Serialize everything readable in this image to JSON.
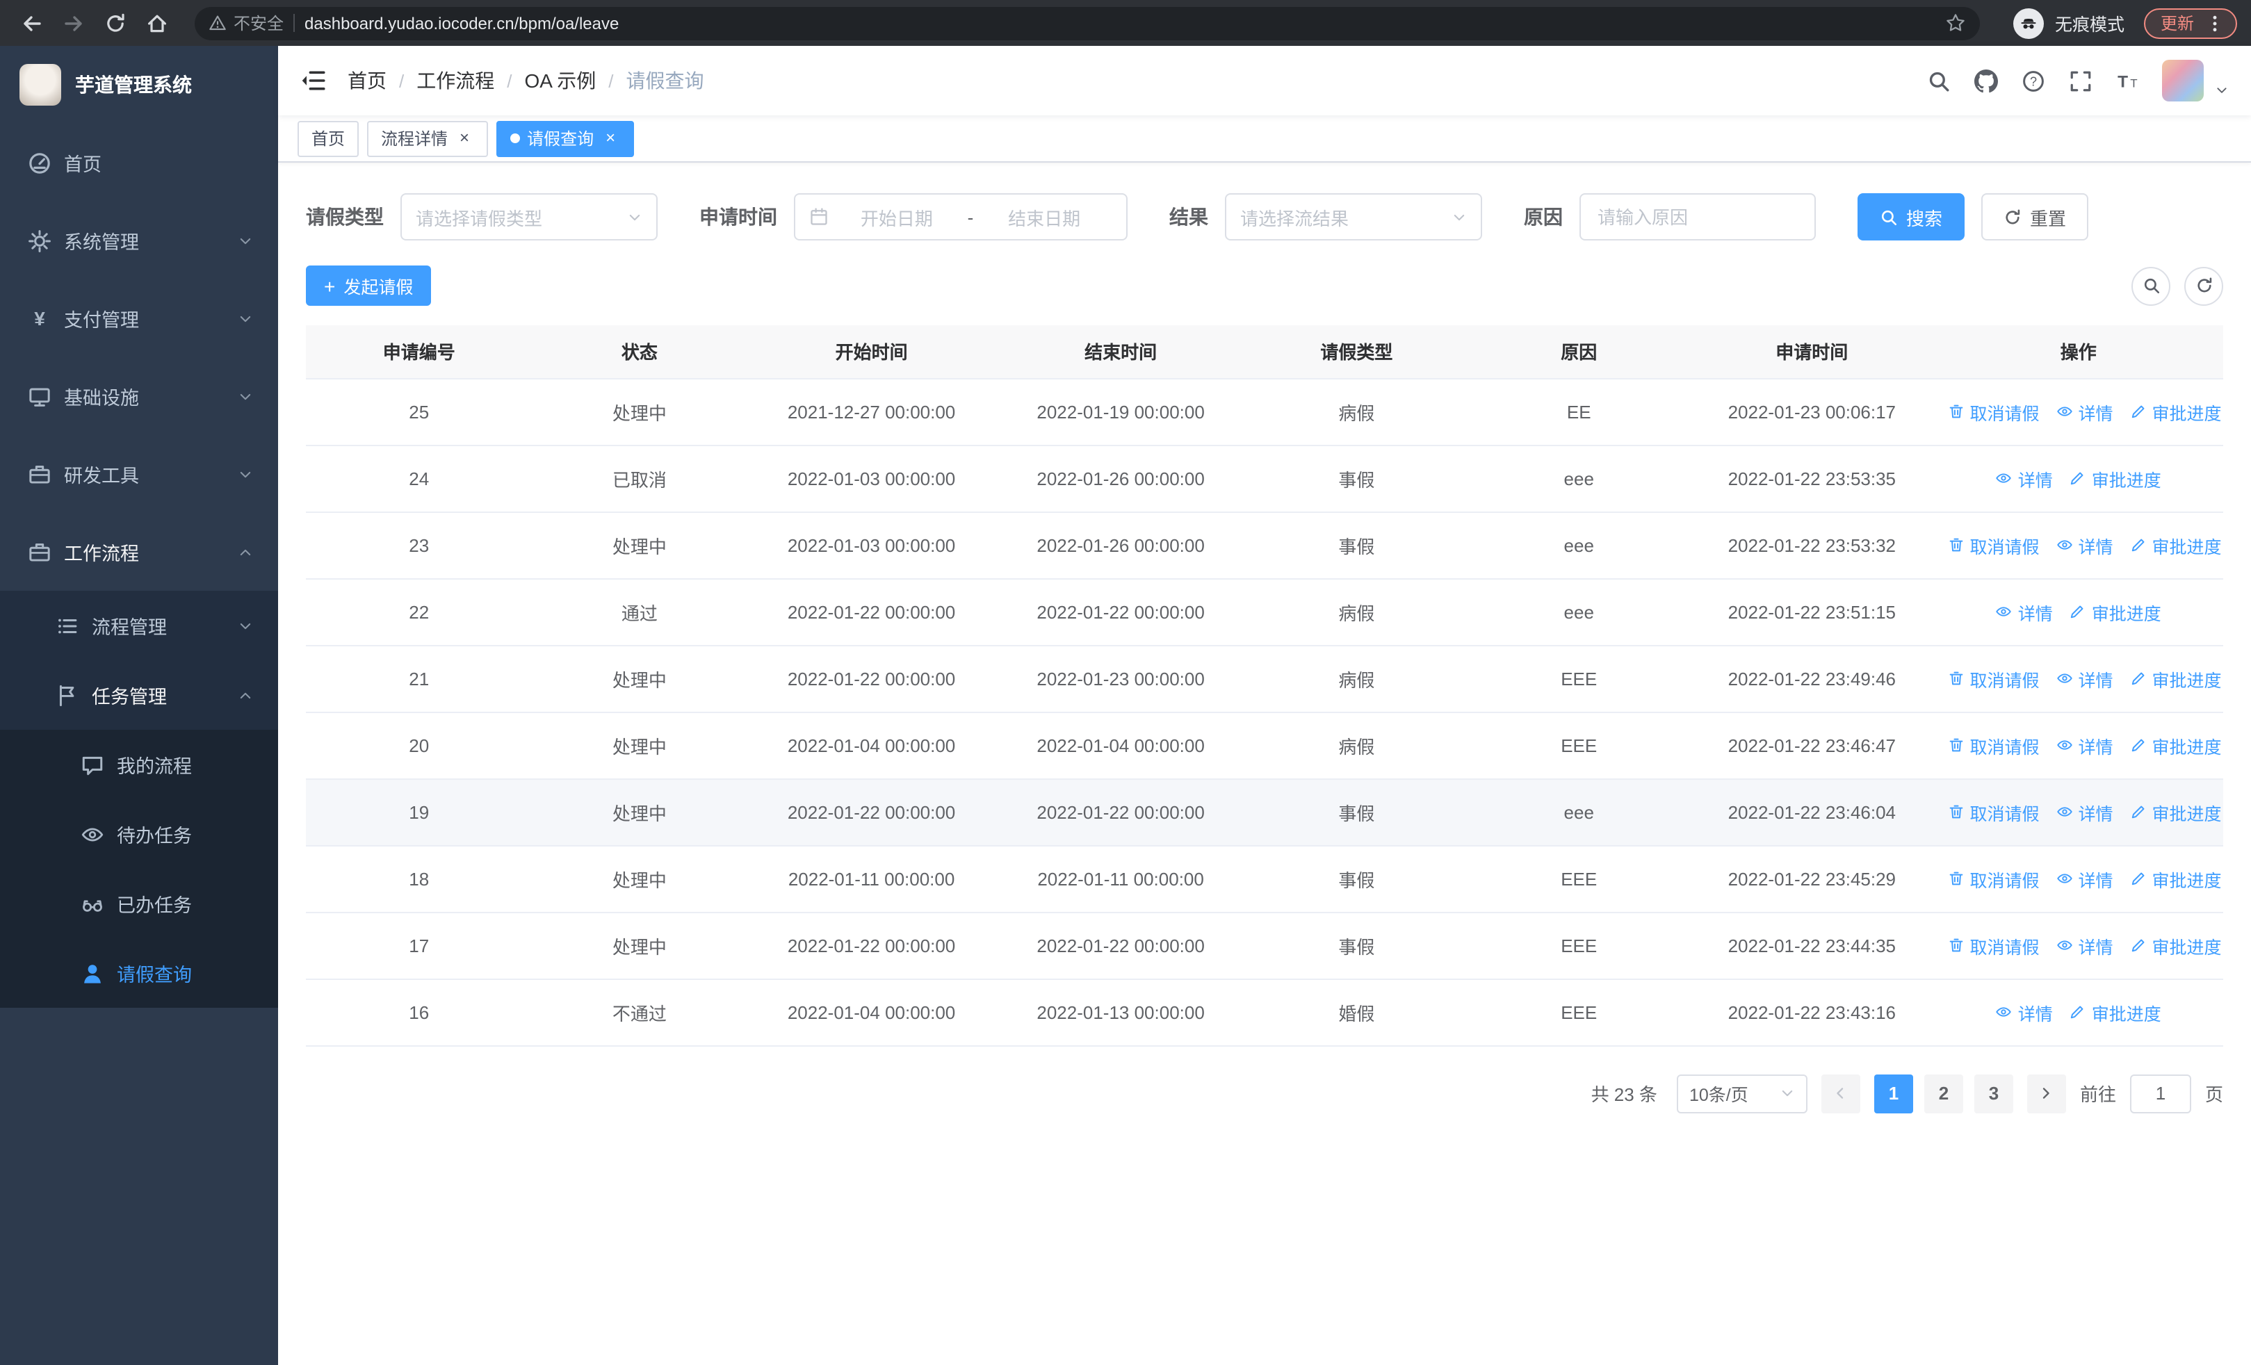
{
  "colors": {
    "accent": "#409eff",
    "sidebar_bg": "#2d3a4d",
    "submenu_bg": "#1b2532"
  },
  "browser": {
    "security_warning": "不安全",
    "url": "dashboard.yudao.iocoder.cn/bpm/oa/leave",
    "incognito_label": "无痕模式",
    "update_label": "更新"
  },
  "sidebar": {
    "logo_title": "芋道管理系统",
    "menu": [
      {
        "key": "home",
        "label": "首页",
        "icon": "dashboard-icon",
        "level": 1
      },
      {
        "key": "system",
        "label": "系统管理",
        "icon": "gear-icon",
        "level": 1,
        "arrow": "down"
      },
      {
        "key": "payment",
        "label": "支付管理",
        "icon": "yen-icon",
        "level": 1,
        "arrow": "down"
      },
      {
        "key": "infrastructure",
        "label": "基础设施",
        "icon": "monitor-icon",
        "level": 1,
        "arrow": "down"
      },
      {
        "key": "dev-tools",
        "label": "研发工具",
        "icon": "suitcase-icon",
        "level": 1,
        "arrow": "down"
      },
      {
        "key": "workflow",
        "label": "工作流程",
        "icon": "suitcase-icon",
        "level": 1,
        "arrow": "up",
        "open": true
      },
      {
        "key": "process-mgmt",
        "label": "流程管理",
        "icon": "list-icon",
        "level": 2,
        "arrow": "down"
      },
      {
        "key": "task-mgmt",
        "label": "任务管理",
        "icon": "flag-icon",
        "level": 2,
        "arrow": "up",
        "open": true
      },
      {
        "key": "my-process",
        "label": "我的流程",
        "icon": "chat-icon",
        "level": 3
      },
      {
        "key": "todo-tasks",
        "label": "待办任务",
        "icon": "eye-icon",
        "level": 3
      },
      {
        "key": "done-tasks",
        "label": "已办任务",
        "icon": "glasses-icon",
        "level": 3
      },
      {
        "key": "leave-query",
        "label": "请假查询",
        "icon": "user-icon",
        "level": 3,
        "active": true
      }
    ]
  },
  "header": {
    "breadcrumb": [
      "首页",
      "工作流程",
      "OA 示例",
      "请假查询"
    ],
    "icons": [
      {
        "name": "search-icon"
      },
      {
        "name": "github-icon"
      },
      {
        "name": "question-icon"
      },
      {
        "name": "fullscreen-icon"
      },
      {
        "name": "font-size-icon"
      }
    ]
  },
  "tabs": [
    {
      "label": "首页",
      "closable": false,
      "active": false
    },
    {
      "label": "流程详情",
      "closable": true,
      "active": false
    },
    {
      "label": "请假查询",
      "closable": true,
      "active": true
    }
  ],
  "filters": {
    "leave_type_label": "请假类型",
    "leave_type_placeholder": "请选择请假类型",
    "apply_time_label": "申请时间",
    "start_date_placeholder": "开始日期",
    "date_separator": "-",
    "end_date_placeholder": "结束日期",
    "result_label": "结果",
    "result_placeholder": "请选择流结果",
    "reason_label": "原因",
    "reason_placeholder": "请输入原因",
    "search_label": "搜索",
    "reset_label": "重置"
  },
  "toolbar": {
    "create_label": "发起请假"
  },
  "table": {
    "headers": [
      "申请编号",
      "状态",
      "开始时间",
      "结束时间",
      "请假类型",
      "原因",
      "申请时间",
      "操作"
    ],
    "action_labels": {
      "cancel": "取消请假",
      "detail": "详情",
      "progress": "审批进度"
    },
    "action_icons": {
      "cancel": "trash-icon",
      "detail": "eye-icon",
      "progress": "edit-icon"
    },
    "rows": [
      {
        "id": "25",
        "status": "处理中",
        "start": "2021-12-27 00:00:00",
        "end": "2022-01-19 00:00:00",
        "type": "病假",
        "reason": "EE",
        "apply_time": "2022-01-23 00:06:17",
        "actions": [
          "cancel",
          "detail",
          "progress"
        ]
      },
      {
        "id": "24",
        "status": "已取消",
        "start": "2022-01-03 00:00:00",
        "end": "2022-01-26 00:00:00",
        "type": "事假",
        "reason": "eee",
        "apply_time": "2022-01-22 23:53:35",
        "actions": [
          "detail",
          "progress"
        ]
      },
      {
        "id": "23",
        "status": "处理中",
        "start": "2022-01-03 00:00:00",
        "end": "2022-01-26 00:00:00",
        "type": "事假",
        "reason": "eee",
        "apply_time": "2022-01-22 23:53:32",
        "actions": [
          "cancel",
          "detail",
          "progress"
        ]
      },
      {
        "id": "22",
        "status": "通过",
        "start": "2022-01-22 00:00:00",
        "end": "2022-01-22 00:00:00",
        "type": "病假",
        "reason": "eee",
        "apply_time": "2022-01-22 23:51:15",
        "actions": [
          "detail",
          "progress"
        ]
      },
      {
        "id": "21",
        "status": "处理中",
        "start": "2022-01-22 00:00:00",
        "end": "2022-01-23 00:00:00",
        "type": "病假",
        "reason": "EEE",
        "apply_time": "2022-01-22 23:49:46",
        "actions": [
          "cancel",
          "detail",
          "progress"
        ]
      },
      {
        "id": "20",
        "status": "处理中",
        "start": "2022-01-04 00:00:00",
        "end": "2022-01-04 00:00:00",
        "type": "病假",
        "reason": "EEE",
        "apply_time": "2022-01-22 23:46:47",
        "actions": [
          "cancel",
          "detail",
          "progress"
        ]
      },
      {
        "id": "19",
        "status": "处理中",
        "start": "2022-01-22 00:00:00",
        "end": "2022-01-22 00:00:00",
        "type": "事假",
        "reason": "eee",
        "apply_time": "2022-01-22 23:46:04",
        "actions": [
          "cancel",
          "detail",
          "progress"
        ],
        "highlighted": true
      },
      {
        "id": "18",
        "status": "处理中",
        "start": "2022-01-11 00:00:00",
        "end": "2022-01-11 00:00:00",
        "type": "事假",
        "reason": "EEE",
        "apply_time": "2022-01-22 23:45:29",
        "actions": [
          "cancel",
          "detail",
          "progress"
        ]
      },
      {
        "id": "17",
        "status": "处理中",
        "start": "2022-01-22 00:00:00",
        "end": "2022-01-22 00:00:00",
        "type": "事假",
        "reason": "EEE",
        "apply_time": "2022-01-22 23:44:35",
        "actions": [
          "cancel",
          "detail",
          "progress"
        ]
      },
      {
        "id": "16",
        "status": "不通过",
        "start": "2022-01-04 00:00:00",
        "end": "2022-01-13 00:00:00",
        "type": "婚假",
        "reason": "EEE",
        "apply_time": "2022-01-22 23:43:16",
        "actions": [
          "detail",
          "progress"
        ]
      }
    ]
  },
  "pagination": {
    "total_text": "共 23 条",
    "page_size": "10条/页",
    "pages": [
      "1",
      "2",
      "3"
    ],
    "active_page": "1",
    "goto_label": "前往",
    "goto_value": "1",
    "page_unit": "页"
  }
}
